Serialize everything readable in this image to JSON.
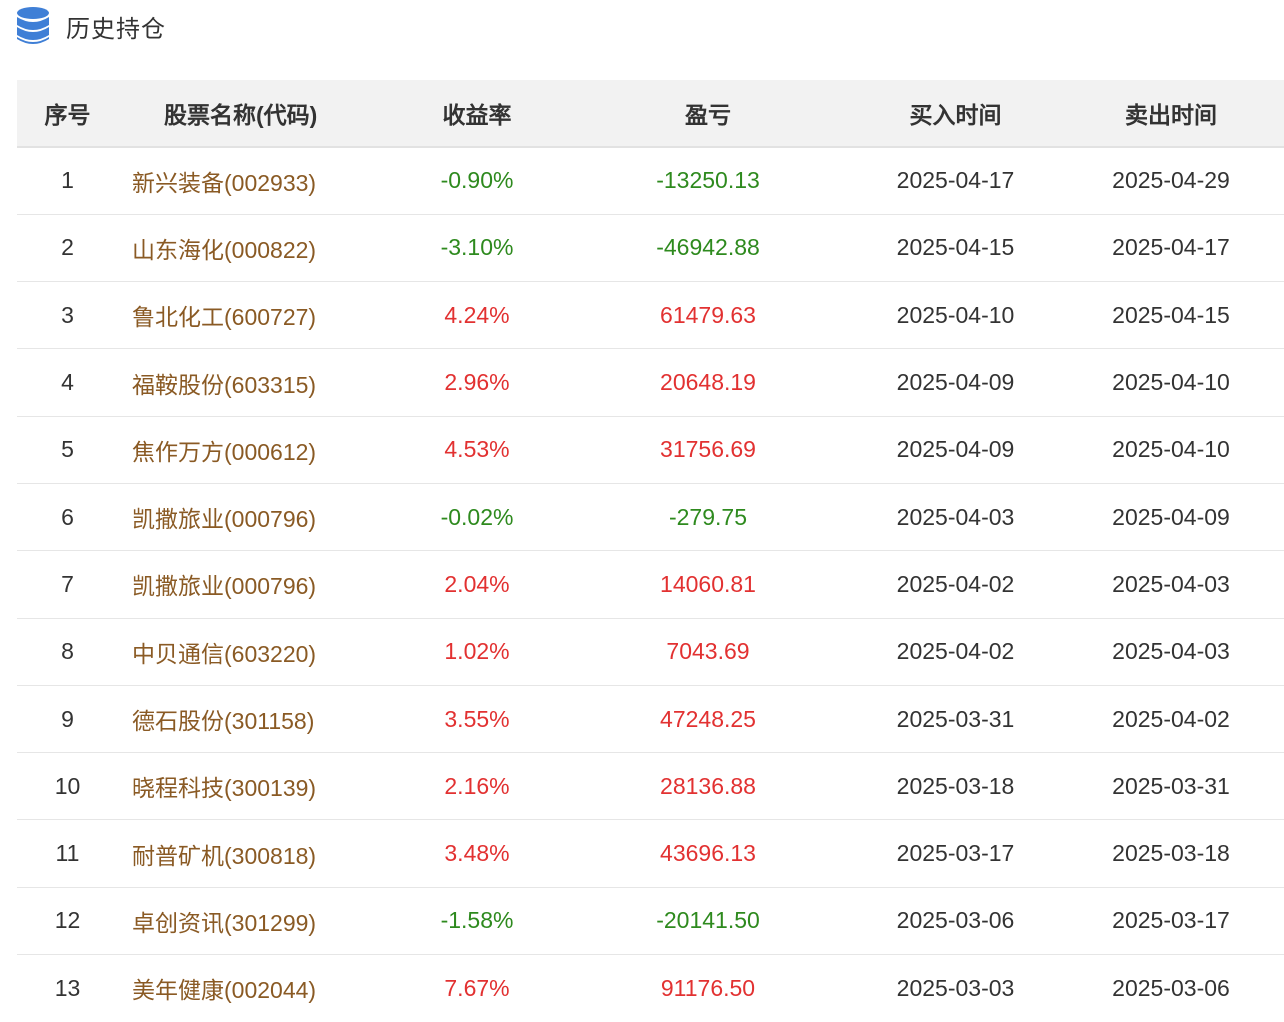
{
  "header": {
    "title": "历史持仓",
    "icon": "database-icon",
    "icon_color": "#3f7fd6"
  },
  "colors": {
    "positive": "#e23131",
    "negative": "#2e8a1e",
    "stock_name": "#8a5a24"
  },
  "table": {
    "columns": [
      "序号",
      "股票名称(代码)",
      "收益率",
      "盈亏",
      "买入时间",
      "卖出时间"
    ],
    "rows": [
      {
        "index": "1",
        "name": "新兴装备(002933)",
        "return": "-0.90%",
        "pnl": "-13250.13",
        "buy": "2025-04-17",
        "sell": "2025-04-29"
      },
      {
        "index": "2",
        "name": "山东海化(000822)",
        "return": "-3.10%",
        "pnl": "-46942.88",
        "buy": "2025-04-15",
        "sell": "2025-04-17"
      },
      {
        "index": "3",
        "name": "鲁北化工(600727)",
        "return": "4.24%",
        "pnl": "61479.63",
        "buy": "2025-04-10",
        "sell": "2025-04-15"
      },
      {
        "index": "4",
        "name": "福鞍股份(603315)",
        "return": "2.96%",
        "pnl": "20648.19",
        "buy": "2025-04-09",
        "sell": "2025-04-10"
      },
      {
        "index": "5",
        "name": "焦作万方(000612)",
        "return": "4.53%",
        "pnl": "31756.69",
        "buy": "2025-04-09",
        "sell": "2025-04-10"
      },
      {
        "index": "6",
        "name": "凯撒旅业(000796)",
        "return": "-0.02%",
        "pnl": "-279.75",
        "buy": "2025-04-03",
        "sell": "2025-04-09"
      },
      {
        "index": "7",
        "name": "凯撒旅业(000796)",
        "return": "2.04%",
        "pnl": "14060.81",
        "buy": "2025-04-02",
        "sell": "2025-04-03"
      },
      {
        "index": "8",
        "name": "中贝通信(603220)",
        "return": "1.02%",
        "pnl": "7043.69",
        "buy": "2025-04-02",
        "sell": "2025-04-03"
      },
      {
        "index": "9",
        "name": "德石股份(301158)",
        "return": "3.55%",
        "pnl": "47248.25",
        "buy": "2025-03-31",
        "sell": "2025-04-02"
      },
      {
        "index": "10",
        "name": "晓程科技(300139)",
        "return": "2.16%",
        "pnl": "28136.88",
        "buy": "2025-03-18",
        "sell": "2025-03-31"
      },
      {
        "index": "11",
        "name": "耐普矿机(300818)",
        "return": "3.48%",
        "pnl": "43696.13",
        "buy": "2025-03-17",
        "sell": "2025-03-18"
      },
      {
        "index": "12",
        "name": "卓创资讯(301299)",
        "return": "-1.58%",
        "pnl": "-20141.50",
        "buy": "2025-03-06",
        "sell": "2025-03-17"
      },
      {
        "index": "13",
        "name": "美年健康(002044)",
        "return": "7.67%",
        "pnl": "91176.50",
        "buy": "2025-03-03",
        "sell": "2025-03-06"
      }
    ]
  }
}
